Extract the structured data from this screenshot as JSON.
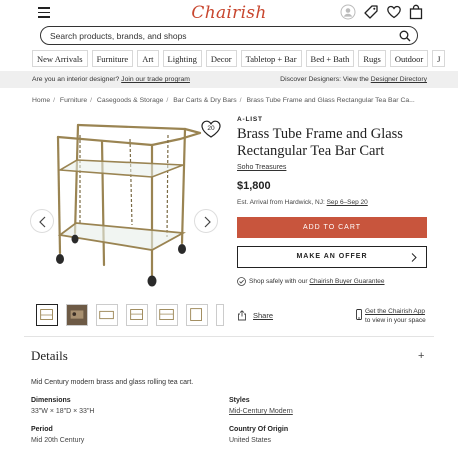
{
  "header": {
    "logo": "Chairish",
    "search_placeholder": "Search products, brands, and shops"
  },
  "nav": [
    "New Arrivals",
    "Furniture",
    "Art",
    "Lighting",
    "Decor",
    "Tabletop + Bar",
    "Bed + Bath",
    "Rugs",
    "Outdoor",
    "J"
  ],
  "banner": {
    "left_text": "Are you an interior designer?",
    "left_link": "Join our trade program",
    "right_text": "Discover Designers: View the",
    "right_link": "Designer Directory"
  },
  "breadcrumb": [
    "Home",
    "Furniture",
    "Casegoods & Storage",
    "Bar Carts & Dry Bars",
    "Brass Tube Frame and Glass Rectangular Tea Bar Ca..."
  ],
  "product": {
    "badge": "A-LIST",
    "title": "Brass Tube Frame and Glass Rectangular Tea Bar Cart",
    "seller": "Soho Treasures",
    "price": "$1,800",
    "arrival_prefix": "Est. Arrival from Hardwick, NJ:",
    "arrival_dates": "Sep 6–Sep 20",
    "favorites_count": "20",
    "add_to_cart": "ADD TO CART",
    "make_offer": "MAKE AN OFFER",
    "safe_text": "Shop safely with our",
    "safe_link": "Chairish Buyer Guarantee",
    "share": "Share",
    "app_line1": "Get the Chairish App",
    "app_line2": "to view in your space"
  },
  "details": {
    "heading": "Details",
    "plus": "+",
    "description": "Mid Century modern brass and glass rolling tea cart.",
    "dimensions_label": "Dimensions",
    "dimensions_value": "33\"W × 18\"D × 33\"H",
    "styles_label": "Styles",
    "styles_value": "Mid-Century Modern",
    "period_label": "Period",
    "period_value": "Mid 20th Century",
    "origin_label": "Country Of Origin",
    "origin_value": "United States"
  },
  "colors": {
    "brand": "#c8462e",
    "cart_button": "#c8553d",
    "banner_bg": "#efefef"
  },
  "icons": [
    "menu-icon",
    "account-icon",
    "tag-icon",
    "heart-icon",
    "bag-icon",
    "search-icon",
    "chevron-left-icon",
    "chevron-right-icon",
    "shield-check-icon",
    "share-icon",
    "phone-icon"
  ]
}
